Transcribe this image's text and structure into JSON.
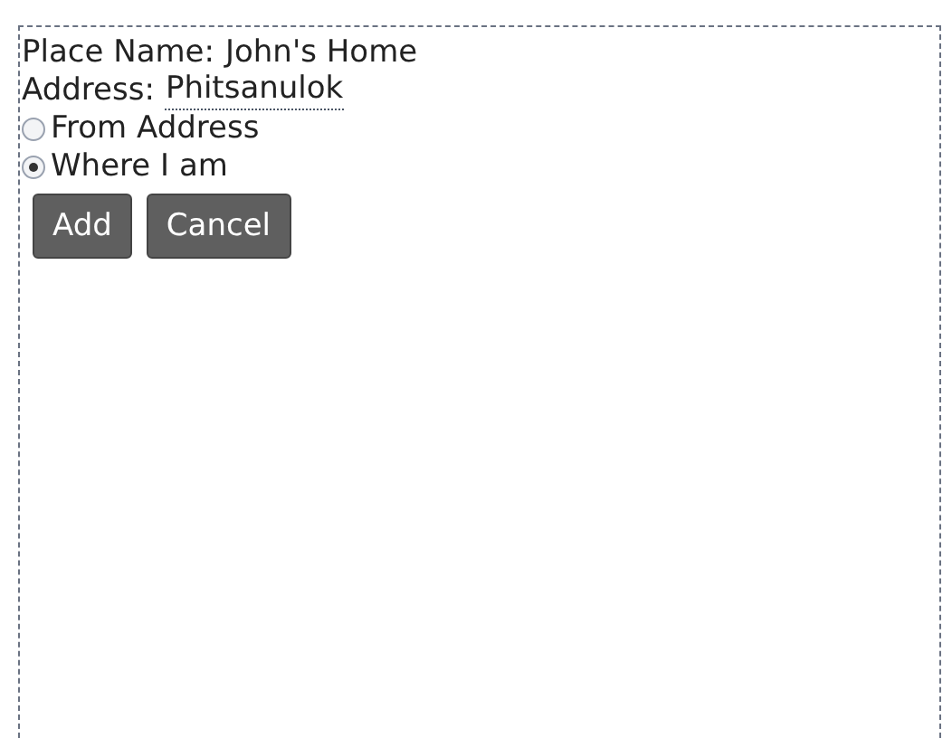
{
  "fields": [
    {
      "label": "Place Name:",
      "value": "John's Home",
      "kind": "text"
    },
    {
      "label": "Address:",
      "value": "Phitsanulok",
      "kind": "edit"
    }
  ],
  "location_options": [
    {
      "label": "From Address",
      "selected": false
    },
    {
      "label": "Where I am",
      "selected": true
    }
  ],
  "buttons": [
    "Add",
    "Cancel"
  ]
}
